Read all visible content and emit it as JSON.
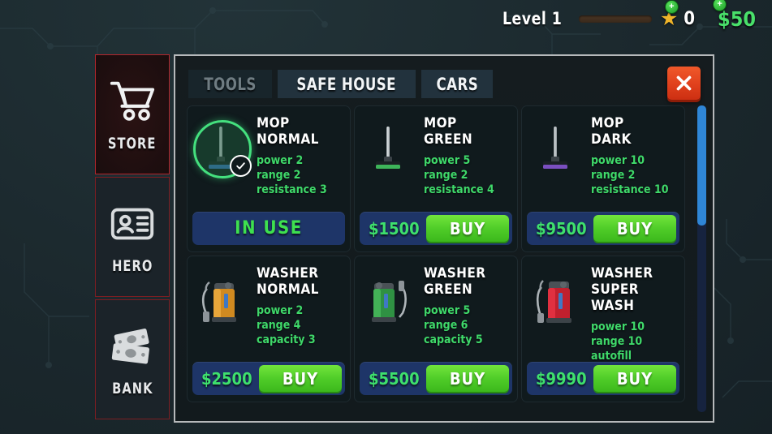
{
  "hud": {
    "level_label": "Level 1",
    "xp_add_icon": "plus-badge-icon",
    "star_icon": "star-icon",
    "star_count": "0",
    "star_add_icon": "plus-badge-icon",
    "money": "$50",
    "money_add_icon": "plus-badge-icon"
  },
  "sidebar": {
    "items": [
      {
        "label": "STORE",
        "icon": "shopping-cart-icon",
        "active": true
      },
      {
        "label": "HERO",
        "icon": "id-card-icon",
        "active": false
      },
      {
        "label": "BANK",
        "icon": "banknotes-icon",
        "active": false
      }
    ]
  },
  "panel": {
    "watermark": "",
    "close_icon": "close-x-icon",
    "tabs": [
      {
        "label": "TOOLS",
        "active": true
      },
      {
        "label": "SAFE HOUSE",
        "active": false
      },
      {
        "label": "CARS",
        "active": false
      }
    ],
    "scrollbar": {
      "position": "top",
      "thumb_fraction": "0.39"
    }
  },
  "items": [
    {
      "title_line1": "MOP",
      "title_line2": "NORMAL",
      "icon": "mop-normal-icon",
      "selected": true,
      "check_icon": "check-icon",
      "stats": [
        "power 2",
        "range 2",
        "resistance 3"
      ],
      "action_type": "in_use",
      "action_label": "IN USE",
      "price": "",
      "buy_label": ""
    },
    {
      "title_line1": "MOP",
      "title_line2": "GREEN",
      "icon": "mop-green-icon",
      "selected": false,
      "check_icon": "",
      "stats": [
        "power 5",
        "range 2",
        "resistance 4"
      ],
      "action_type": "buy",
      "action_label": "",
      "price": "$1500",
      "buy_label": "BUY"
    },
    {
      "title_line1": "MOP",
      "title_line2": "DARK",
      "icon": "mop-dark-icon",
      "selected": false,
      "check_icon": "",
      "stats": [
        "power 10",
        "range 2",
        "resistance 10"
      ],
      "action_type": "buy",
      "action_label": "",
      "price": "$9500",
      "buy_label": "BUY"
    },
    {
      "title_line1": "WASHER",
      "title_line2": "NORMAL",
      "icon": "washer-orange-icon",
      "selected": false,
      "check_icon": "",
      "stats": [
        "power 2",
        "range 4",
        "capacity 3"
      ],
      "action_type": "buy",
      "action_label": "",
      "price": "$2500",
      "buy_label": "BUY"
    },
    {
      "title_line1": "WASHER",
      "title_line2": "GREEN",
      "icon": "washer-green-icon",
      "selected": false,
      "check_icon": "",
      "stats": [
        "power 5",
        "range 6",
        "capacity 5"
      ],
      "action_type": "buy",
      "action_label": "",
      "price": "$5500",
      "buy_label": "BUY"
    },
    {
      "title_line1": "WASHER",
      "title_line2": "SUPER WASH",
      "icon": "washer-red-icon",
      "selected": false,
      "check_icon": "",
      "stats": [
        "power 10",
        "range 10",
        "autofill"
      ],
      "action_type": "buy",
      "action_label": "",
      "price": "$9990",
      "buy_label": "BUY"
    }
  ],
  "colors": {
    "accent_green": "#3fd96a",
    "buy_green": "#4fcc28",
    "money_green": "#49e06a",
    "action_navy": "#1e3568",
    "close_red": "#e0401c",
    "nav_border_red": "#b3262c",
    "scroll_blue": "#2f86d6",
    "background": "#1d2b30"
  }
}
